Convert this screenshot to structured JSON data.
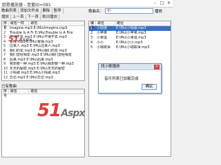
{
  "window": {
    "title": "欧歌播放器 - 音量ID=081",
    "min": "–",
    "max": "□",
    "close": "✕"
  },
  "toolbar": [
    "歌曲列表",
    "添加文件夹",
    "删除",
    "暂停"
  ],
  "toolbar2": [
    "播放",
    "上一首",
    "下一首",
    "歌词播放"
  ],
  "left_list": {
    "headers": [
      "序号",
      "歌名一样",
      "歌名"
    ],
    "rows": [
      [
        "1",
        "Imagine.mp3 E:\\Mu\\Imagine.mp3"
      ],
      [
        "2",
        "Trouble Is A Fr  E:\\Mu\\Trouble Is A Frie"
      ],
      [
        "3",
        "不得不爱.mp3  E:\\Mu\\不得不爱.mp3"
      ],
      [
        "4",
        "曹操.mp3  E:\\Mu\\曹操.mp3"
      ],
      [
        "5",
        "过来人.mp3  E:\\Mu\\过来人.mp3"
      ],
      [
        "6",
        "我们的爱.mp3  E:\\Mu\\我们的爱.mp3"
      ],
      [
        "7",
        "我们曾经相爱.mp3  E:\\Mu\\我们曾经相爱"
      ],
      [
        "8",
        "后来.mp3  E:\\Mu\\后来.mp3"
      ],
      [
        "9",
        "我想要一种.mp3  E:\\Mu\\我想要一种.mp3"
      ],
      [
        "10",
        "冬天的秘密.mp3  E:\\Mu\\冬天的秘密"
      ],
      [
        "11",
        "小情歌.mp3  E:\\Mu\\小情歌.mp3"
      ],
      [
        "12",
        "忘记.mp3  E:\\Mu\\忘记.mp3"
      ]
    ]
  },
  "lower_label": "已有歌曲",
  "lower_list": {
    "headers": [
      "序号",
      "歌名",
      "歌名"
    ]
  },
  "right_panel": {
    "label": "歌曲名：",
    "input_value": "小",
    "menu": "播放"
  },
  "right_list": {
    "headers": [
      "编号",
      "歌名",
      "路径"
    ],
    "rows": [
      [
        "1",
        "小情歌",
        "E:\\Mu\\小情歌.mp3"
      ],
      [
        "2",
        "小苹果",
        "E:\\Mu\\小苹果.mp3"
      ],
      [
        "3",
        "小幸运",
        "E:\\Mu\\小幸运.mp3"
      ],
      [
        "4",
        "小小",
        "E:\\Mu\\小小.mp3"
      ],
      [
        "5",
        "小城故事",
        "E:\\Mu\\小城故事.mp3"
      ]
    ],
    "selected_index": 0
  },
  "dialog": {
    "title": "找小歌播放",
    "message": "音乐列表已加载完成",
    "ok": "确定",
    "close": "✕"
  },
  "watermarks": {
    "w1_main": "51",
    "w1_sub": "Aspx",
    "w2_main": "51",
    "w2_sub": "Aspx",
    "w3": ".com"
  },
  "colors": {
    "selection": "#3a6fc4",
    "watermark_red": "#dc2828"
  }
}
